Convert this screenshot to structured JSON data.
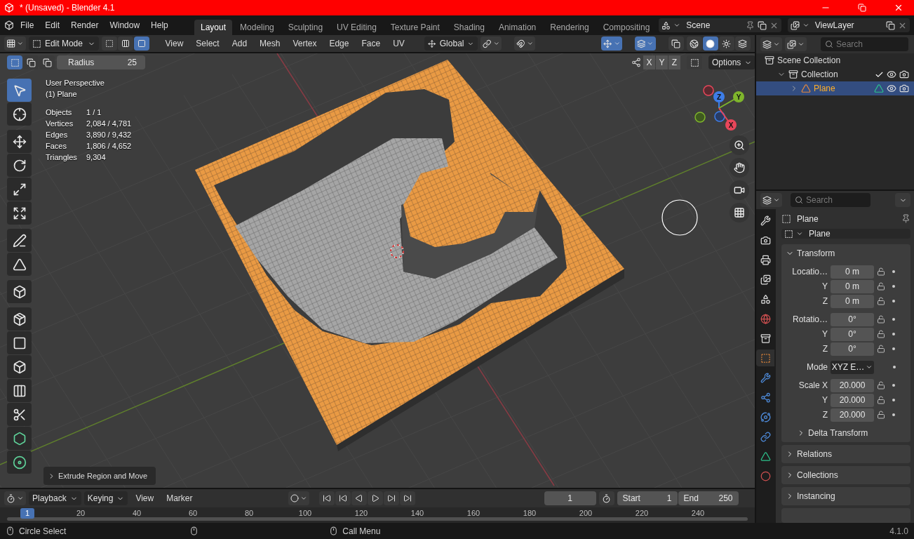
{
  "title_bar": {
    "title": "* (Unsaved) - Blender 4.1"
  },
  "menu": [
    "File",
    "Edit",
    "Render",
    "Window",
    "Help"
  ],
  "workspaces": [
    {
      "label": "Layout",
      "selected": true
    },
    {
      "label": "Modeling",
      "selected": false
    },
    {
      "label": "Sculpting",
      "selected": false
    },
    {
      "label": "UV Editing",
      "selected": false
    },
    {
      "label": "Texture Paint",
      "selected": false
    },
    {
      "label": "Shading",
      "selected": false
    },
    {
      "label": "Animation",
      "selected": false
    },
    {
      "label": "Rendering",
      "selected": false
    },
    {
      "label": "Compositing",
      "selected": false
    }
  ],
  "scene": "Scene",
  "view_layer": "ViewLayer",
  "viewport": {
    "mode": "Edit Mode",
    "select_modes": [
      {
        "kind": "vertex",
        "selected": false
      },
      {
        "kind": "edge",
        "selected": false
      },
      {
        "kind": "face",
        "selected": true
      }
    ],
    "menus": [
      "View",
      "Select",
      "Add",
      "Mesh",
      "Vertex",
      "Edge",
      "Face",
      "UV"
    ],
    "orientation": "Global",
    "toggles": [
      {
        "kind": "snap",
        "on": false
      },
      {
        "kind": "gizmo",
        "on": true
      },
      {
        "kind": "overlays",
        "on": true
      }
    ],
    "shading": [
      {
        "kind": "wireframe",
        "selected": false
      },
      {
        "kind": "solid",
        "selected": true
      },
      {
        "kind": "material",
        "selected": false
      },
      {
        "kind": "rendered",
        "selected": false
      }
    ],
    "tool_setting": {
      "label": "Radius",
      "value": "25"
    },
    "mirror_axes": [
      "X",
      "Y",
      "Z"
    ],
    "options": "Options",
    "info": [
      "User Perspective",
      "(1) Plane"
    ],
    "stats": [
      {
        "label": "Objects",
        "value": "1 / 1"
      },
      {
        "label": "Vertices",
        "value": "2,084 / 4,781"
      },
      {
        "label": "Edges",
        "value": "3,890 / 9,432"
      },
      {
        "label": "Faces",
        "value": "1,806 / 4,652"
      },
      {
        "label": "Triangles",
        "value": "9,304"
      }
    ],
    "tools": [
      {
        "kind": "select",
        "selected": true
      },
      {
        "kind": "cursor",
        "selected": false
      },
      {
        "kind": "move",
        "selected": false
      },
      {
        "kind": "rotate",
        "selected": false
      },
      {
        "kind": "scale",
        "selected": false
      },
      {
        "kind": "transform",
        "selected": false
      },
      {
        "kind": "annotate",
        "selected": false
      },
      {
        "kind": "measure",
        "selected": false
      },
      {
        "kind": "add-cube",
        "selected": false
      },
      {
        "kind": "extrude",
        "selected": false
      },
      {
        "kind": "inset",
        "selected": false
      },
      {
        "kind": "bevel",
        "selected": false
      },
      {
        "kind": "loop-cut",
        "selected": false
      },
      {
        "kind": "knife",
        "selected": false
      },
      {
        "kind": "poly-build",
        "selected": false
      },
      {
        "kind": "spin",
        "selected": false
      }
    ],
    "gizmo": [
      {
        "label": "Z"
      },
      {
        "label": "Y"
      },
      {
        "label": "X"
      }
    ],
    "last_operator": "Extrude Region and Move"
  },
  "outliner": {
    "search_placeholder": "Search",
    "tree": [
      {
        "label": "Scene Collection",
        "kind": "scene",
        "selected": false,
        "children": [
          {
            "label": "Collection",
            "kind": "collection",
            "selected": false,
            "expanded": true,
            "checked": true,
            "children": [
              {
                "label": "Plane",
                "kind": "mesh-object",
                "selected": true,
                "expanded": false
              }
            ]
          }
        ]
      }
    ]
  },
  "properties": {
    "search_placeholder": "Search",
    "tabs": [
      {
        "kind": "tool",
        "selected": false
      },
      {
        "kind": "render",
        "selected": false
      },
      {
        "kind": "output",
        "selected": false
      },
      {
        "kind": "view-layer",
        "selected": false
      },
      {
        "kind": "scene",
        "selected": false
      },
      {
        "kind": "world",
        "selected": false
      },
      {
        "kind": "collection",
        "selected": false
      },
      {
        "kind": "object",
        "selected": true
      },
      {
        "kind": "modifiers",
        "selected": false
      },
      {
        "kind": "particles",
        "selected": false
      },
      {
        "kind": "physics",
        "selected": false
      },
      {
        "kind": "constraints",
        "selected": false
      },
      {
        "kind": "data",
        "selected": false
      },
      {
        "kind": "material",
        "selected": false
      }
    ],
    "header": "Plane",
    "object_name": "Plane",
    "transform": {
      "title": "Transform",
      "expanded": true,
      "groups": [
        [
          {
            "label": "Locatio…",
            "value": "0 m",
            "kind": "number"
          },
          {
            "label": "Y",
            "value": "0 m",
            "kind": "number"
          },
          {
            "label": "Z",
            "value": "0 m",
            "kind": "number"
          }
        ],
        [
          {
            "label": "Rotatio…",
            "value": "0°",
            "kind": "number"
          },
          {
            "label": "Y",
            "value": "0°",
            "kind": "number"
          },
          {
            "label": "Z",
            "value": "0°",
            "kind": "number"
          }
        ],
        [
          {
            "label": "Mode",
            "value": "XYZ E…",
            "kind": "dropdown"
          }
        ],
        [
          {
            "label": "Scale X",
            "value": "20.000",
            "kind": "number"
          },
          {
            "label": "Y",
            "value": "20.000",
            "kind": "number"
          },
          {
            "label": "Z",
            "value": "20.000",
            "kind": "number"
          }
        ]
      ],
      "subpanel": {
        "title": "Delta Transform",
        "expanded": false
      }
    },
    "panels": [
      {
        "title": "Relations",
        "expanded": false
      },
      {
        "title": "Collections",
        "expanded": false
      },
      {
        "title": "Instancing",
        "expanded": false
      }
    ]
  },
  "timeline": {
    "menus": [
      {
        "label": "Playback",
        "kind": "dropdown"
      },
      {
        "label": "Keying",
        "kind": "dropdown"
      },
      {
        "label": "View",
        "kind": "menu"
      },
      {
        "label": "Marker",
        "kind": "menu"
      }
    ],
    "current_frame": "1",
    "start": {
      "label": "Start",
      "value": "1"
    },
    "end": {
      "label": "End",
      "value": "250"
    },
    "ticks": [
      "20",
      "40",
      "60",
      "80",
      "100",
      "120",
      "140",
      "160",
      "180",
      "200",
      "220",
      "240"
    ],
    "playhead": "1"
  },
  "status_bar": {
    "hints": [
      "Circle Select",
      "Call Menu"
    ],
    "version": "4.1.0"
  }
}
